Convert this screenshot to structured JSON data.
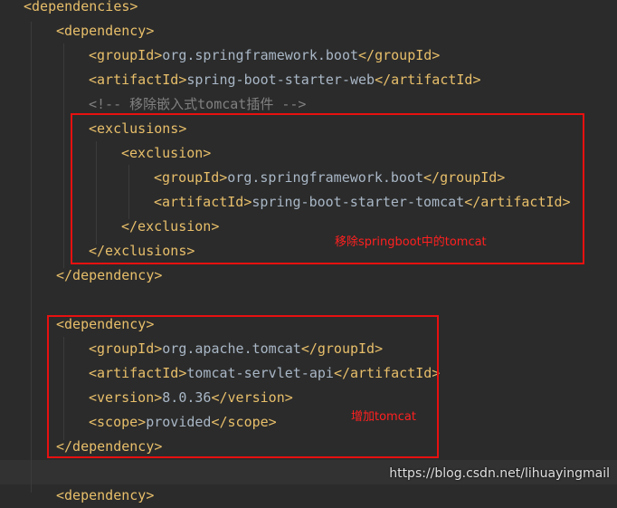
{
  "code_lines": [
    {
      "indent": 0,
      "parts": [
        {
          "t": "tag",
          "v": "<dependencies>"
        }
      ]
    },
    {
      "indent": 1,
      "parts": [
        {
          "t": "tag",
          "v": "<dependency>"
        }
      ]
    },
    {
      "indent": 2,
      "parts": [
        {
          "t": "tag",
          "v": "<groupId>"
        },
        {
          "t": "text",
          "v": "org.springframework.boot"
        },
        {
          "t": "tag",
          "v": "</groupId>"
        }
      ]
    },
    {
      "indent": 2,
      "parts": [
        {
          "t": "tag",
          "v": "<artifactId>"
        },
        {
          "t": "text",
          "v": "spring-boot-starter-web"
        },
        {
          "t": "tag",
          "v": "</artifactId>"
        }
      ]
    },
    {
      "indent": 2,
      "parts": [
        {
          "t": "comment",
          "v": "<!-- 移除嵌入式tomcat插件 -->"
        }
      ]
    },
    {
      "indent": 2,
      "parts": [
        {
          "t": "tag",
          "v": "<exclusions>"
        }
      ]
    },
    {
      "indent": 3,
      "parts": [
        {
          "t": "tag",
          "v": "<exclusion>"
        }
      ]
    },
    {
      "indent": 4,
      "parts": [
        {
          "t": "tag",
          "v": "<groupId>"
        },
        {
          "t": "text",
          "v": "org.springframework.boot"
        },
        {
          "t": "tag",
          "v": "</groupId>"
        }
      ]
    },
    {
      "indent": 4,
      "parts": [
        {
          "t": "tag",
          "v": "<artifactId>"
        },
        {
          "t": "text",
          "v": "spring-boot-starter-tomcat"
        },
        {
          "t": "tag",
          "v": "</artifactId>"
        }
      ]
    },
    {
      "indent": 3,
      "parts": [
        {
          "t": "tag",
          "v": "</exclusion>"
        }
      ]
    },
    {
      "indent": 2,
      "parts": [
        {
          "t": "tag",
          "v": "</exclusions>"
        }
      ]
    },
    {
      "indent": 1,
      "parts": [
        {
          "t": "tag",
          "v": "</dependency>"
        }
      ]
    },
    {
      "indent": 0,
      "parts": []
    },
    {
      "indent": 1,
      "parts": [
        {
          "t": "tag",
          "v": "<dependency>"
        }
      ]
    },
    {
      "indent": 2,
      "parts": [
        {
          "t": "tag",
          "v": "<groupId>"
        },
        {
          "t": "text",
          "v": "org.apache.tomcat"
        },
        {
          "t": "tag",
          "v": "</groupId>"
        }
      ]
    },
    {
      "indent": 2,
      "parts": [
        {
          "t": "tag",
          "v": "<artifactId>"
        },
        {
          "t": "text",
          "v": "tomcat-servlet-api"
        },
        {
          "t": "tag",
          "v": "</artifactId>"
        }
      ]
    },
    {
      "indent": 2,
      "parts": [
        {
          "t": "tag",
          "v": "<version>"
        },
        {
          "t": "text",
          "v": "8.0.36"
        },
        {
          "t": "tag",
          "v": "</version>"
        }
      ]
    },
    {
      "indent": 2,
      "parts": [
        {
          "t": "tag",
          "v": "<scope>"
        },
        {
          "t": "text",
          "v": "provided"
        },
        {
          "t": "tag",
          "v": "</scope>"
        }
      ]
    },
    {
      "indent": 1,
      "parts": [
        {
          "t": "tag",
          "v": "</dependency>"
        }
      ]
    },
    {
      "indent": 0,
      "parts": []
    },
    {
      "indent": 1,
      "parts": [
        {
          "t": "tag",
          "v": "<dependency>"
        }
      ]
    }
  ],
  "annotations": {
    "remove_note": "移除springboot中的tomcat",
    "add_note": "增加tomcat"
  },
  "watermark": "https://blog.csdn.net/lihuayingmail",
  "colors": {
    "background": "#2b2b2b",
    "tag": "#e8bf6a",
    "text": "#a9b7c6",
    "comment": "#808080",
    "highlight_box": "#e81010"
  }
}
